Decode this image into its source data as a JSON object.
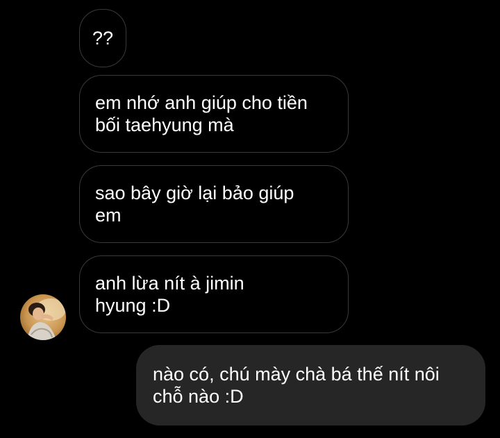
{
  "conversation": {
    "messages": [
      {
        "sender": "other",
        "text": "??"
      },
      {
        "sender": "other",
        "text": "em nhớ anh giúp cho tiền\nbối taehyung mà"
      },
      {
        "sender": "other",
        "text": "sao bây giờ lại bảo giúp\nem"
      },
      {
        "sender": "other",
        "text": "anh lừa nít à jimin\nhyung :D"
      },
      {
        "sender": "me",
        "text": "nào có, chú mày chà bá thế nít nôi\nchỗ nào :D"
      }
    ]
  },
  "colors": {
    "background": "#000000",
    "incoming_border": "#3a3a3a",
    "outgoing_bubble": "#262626",
    "text": "#ffffff"
  },
  "icons": {
    "avatar": "contact-avatar-photo"
  }
}
